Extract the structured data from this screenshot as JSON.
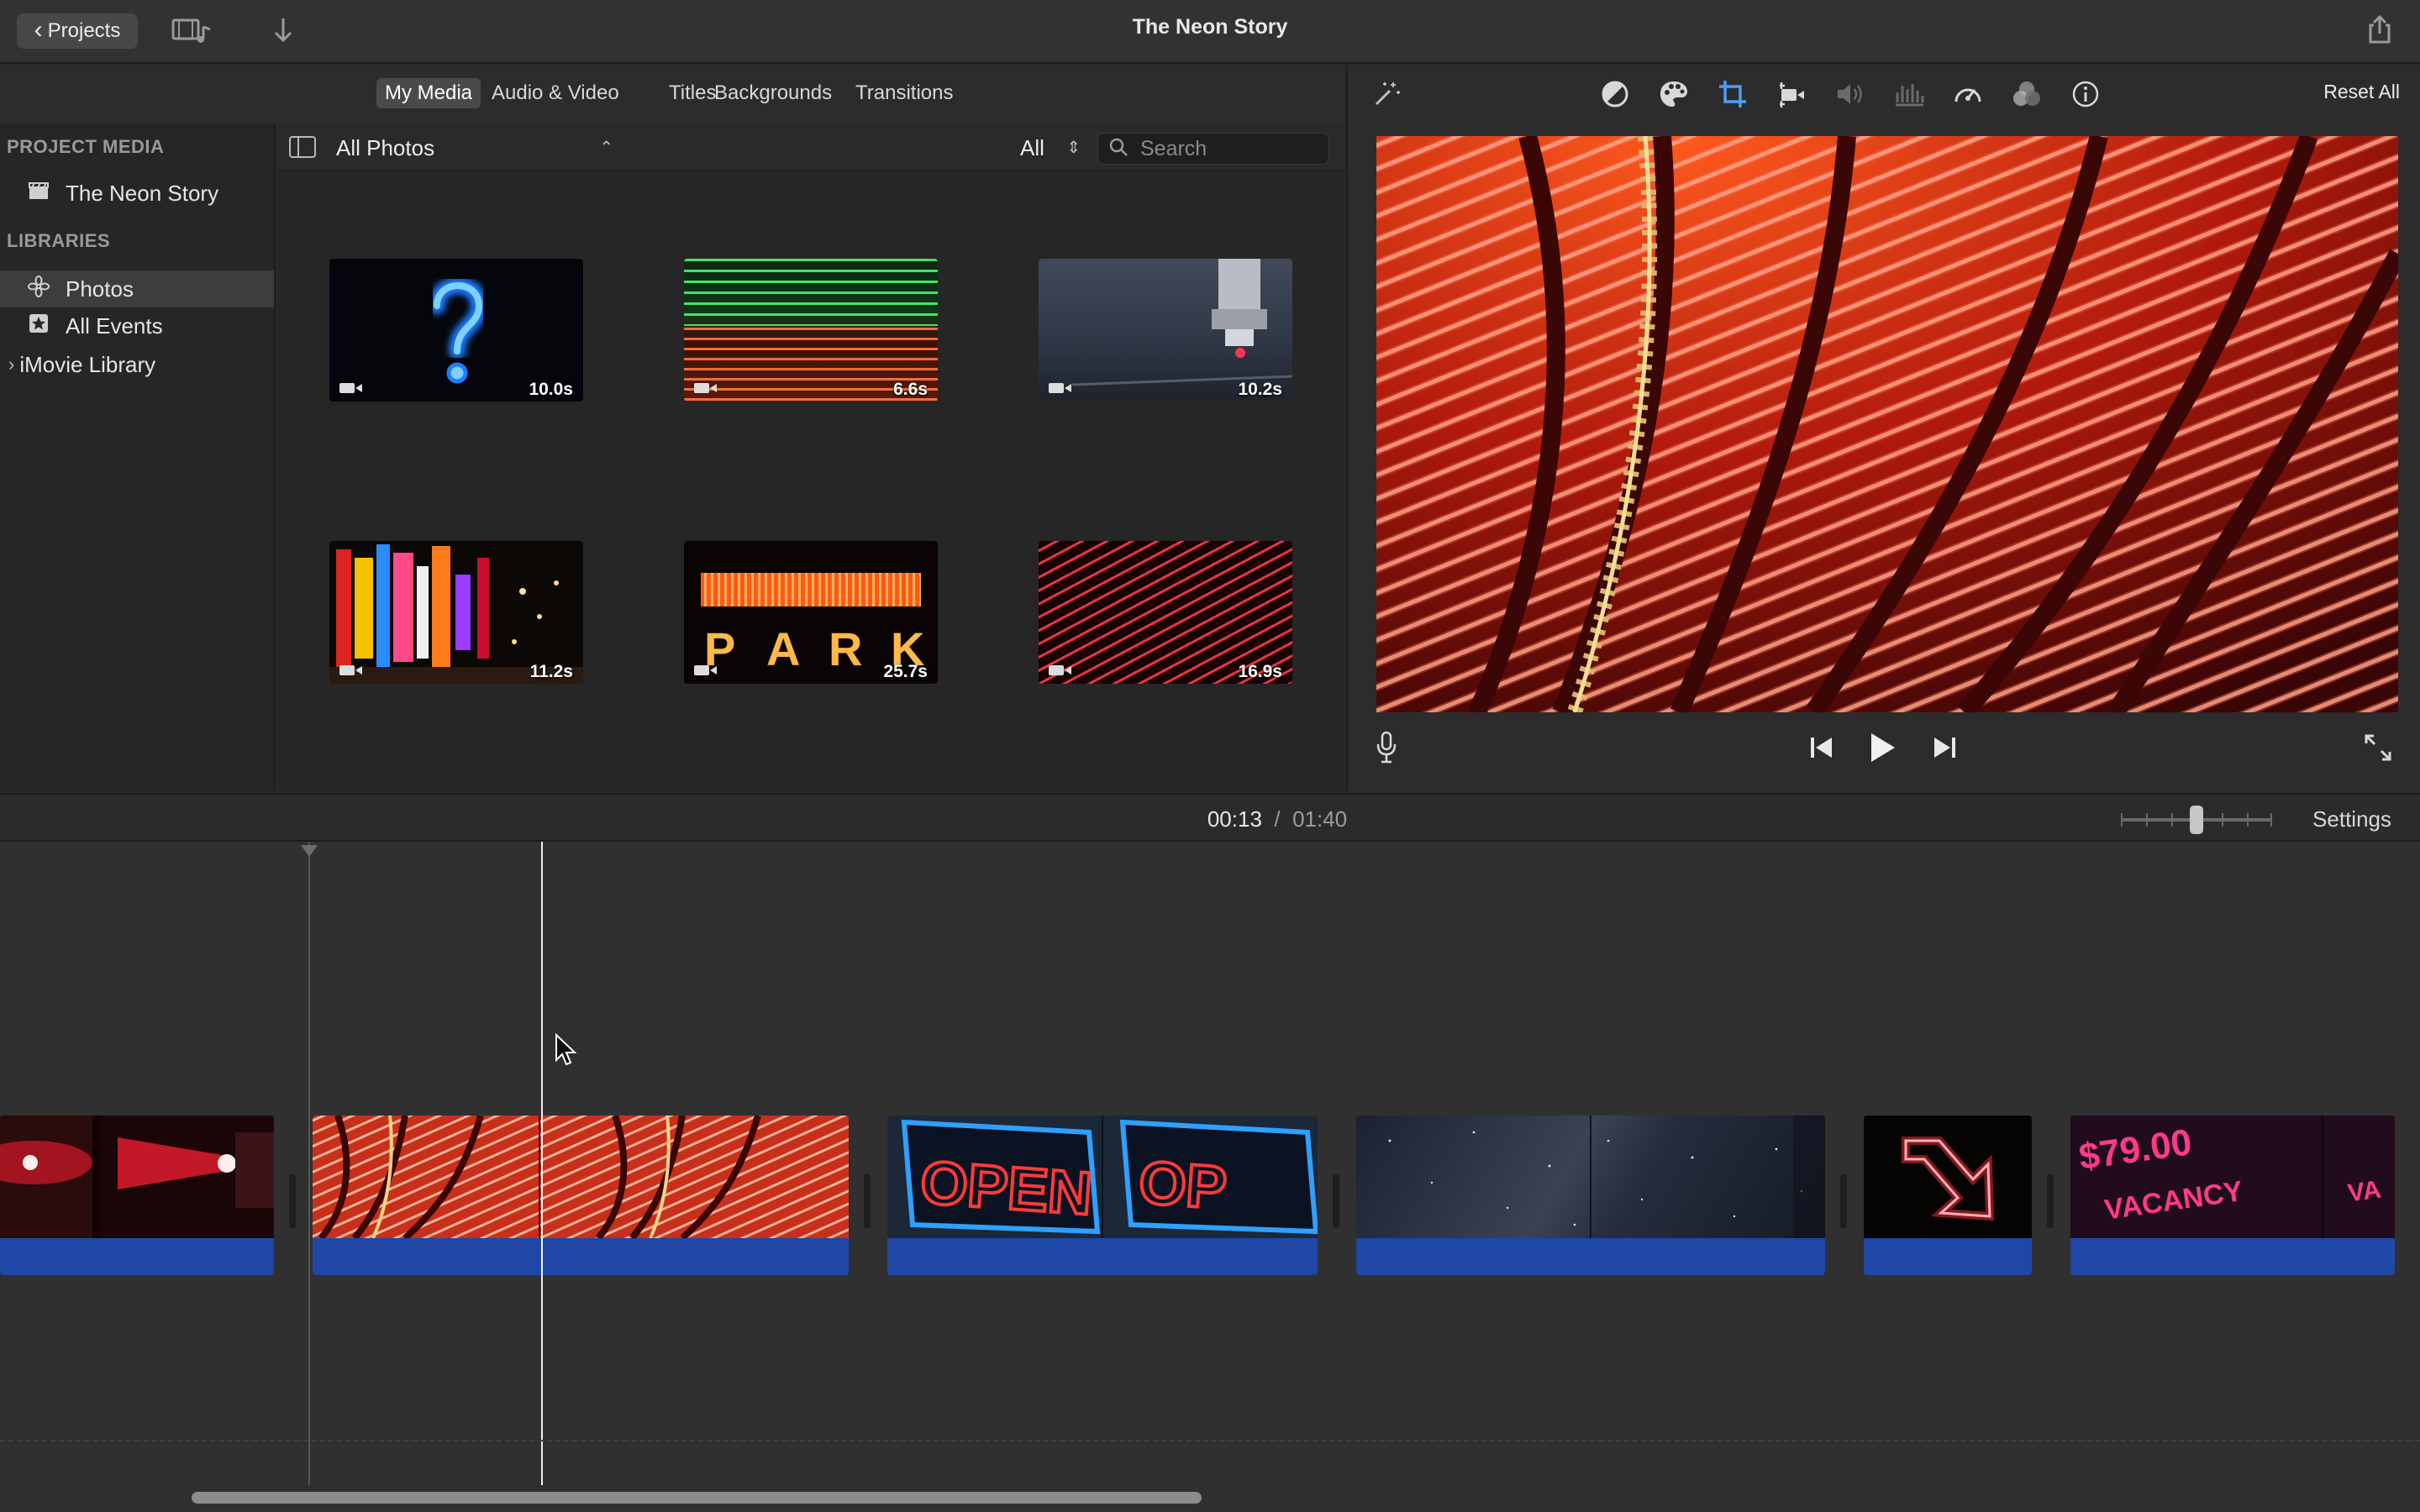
{
  "window": {
    "title": "The Neon Story",
    "back_label": "Projects",
    "icons": [
      "media-toggle-icon",
      "import-arrow-icon",
      "share-icon"
    ]
  },
  "browser_tabs": [
    {
      "label": "My Media",
      "active": true
    },
    {
      "label": "Audio & Video",
      "active": false
    },
    {
      "label": "Titles",
      "active": false
    },
    {
      "label": "Backgrounds",
      "active": false
    },
    {
      "label": "Transitions",
      "active": false
    }
  ],
  "sidebar": {
    "project_media_header": "PROJECT MEDIA",
    "project_item": "The Neon Story",
    "libraries_header": "LIBRARIES",
    "library_items": [
      {
        "label": "Photos",
        "icon": "photos-icon",
        "selected": true
      },
      {
        "label": "All Events",
        "icon": "star-icon",
        "selected": false
      },
      {
        "label": "iMovie Library",
        "icon": "disclosure-chevron-icon",
        "selected": false
      }
    ]
  },
  "browser": {
    "album": "All Photos",
    "filter": "All",
    "search_placeholder": "Search",
    "clips": [
      {
        "duration": "10.0s",
        "subject": "neon question mark"
      },
      {
        "duration": "6.6s",
        "subject": "green and red neon lines"
      },
      {
        "duration": "10.2s",
        "subject": "machine close-up"
      },
      {
        "duration": "11.2s",
        "subject": "city neon signs"
      },
      {
        "duration": "25.7s",
        "subject": "park neon sign"
      },
      {
        "duration": "16.9s",
        "subject": "red diagonal neon"
      }
    ]
  },
  "viewer": {
    "reset_label": "Reset All",
    "adjust_icons": [
      "magic-wand-icon",
      "color-balance-icon",
      "color-correction-icon",
      "crop-icon",
      "stabilization-icon",
      "volume-icon",
      "noise-reduction-icon",
      "speed-icon",
      "clip-filter-icon",
      "info-icon"
    ],
    "active_tool": "crop-icon"
  },
  "timeline": {
    "current_time": "00:13",
    "separator": "/",
    "total_time": "01:40",
    "settings_label": "Settings",
    "zoom_level": 0.5
  },
  "colors": {
    "accent": "#4a9eff",
    "clip_bar": "#1e47a6",
    "background": "#2a2a2a"
  }
}
